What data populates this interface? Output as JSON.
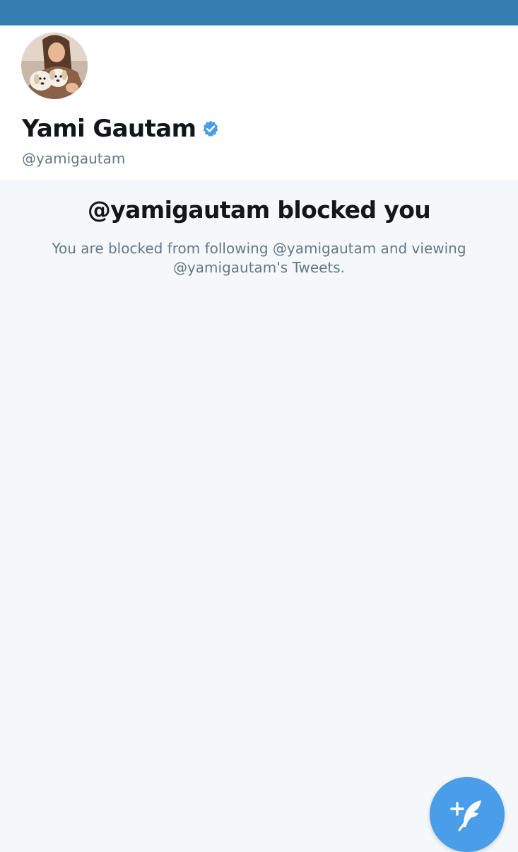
{
  "profile": {
    "display_name": "Yami Gautam",
    "handle": "@yamigautam",
    "verified": true,
    "avatar": "profile-photo-with-puppies"
  },
  "blocked": {
    "title": "@yamigautam blocked you",
    "message": "You are blocked from following @yamigautam and viewing @yamigautam's Tweets."
  },
  "compose": {
    "icon": "compose-tweet-icon"
  },
  "colors": {
    "banner": "#357fb0",
    "accent": "#4a9de8",
    "background": "#f5f8fa",
    "text_primary": "#14171a",
    "text_secondary": "#657786"
  }
}
